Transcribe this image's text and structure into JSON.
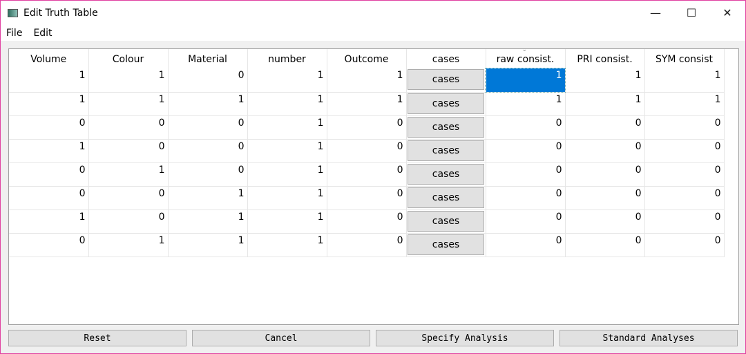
{
  "window": {
    "title": "Edit Truth Table",
    "minimize": "—",
    "maximize": "☐",
    "close": "✕"
  },
  "menu": [
    "File",
    "Edit"
  ],
  "table": {
    "headers": [
      "Volume",
      "Colour",
      "Material",
      "number",
      "Outcome",
      "cases",
      "raw consist.",
      "PRI consist.",
      "SYM consist"
    ],
    "cases_label": "cases",
    "selected": {
      "row": 0,
      "column": "raw consist."
    },
    "rows": [
      [
        "1",
        "1",
        "0",
        "1",
        "1",
        "1",
        "1",
        "1"
      ],
      [
        "1",
        "1",
        "1",
        "1",
        "1",
        "1",
        "1",
        "1"
      ],
      [
        "0",
        "0",
        "0",
        "1",
        "0",
        "0",
        "0",
        "0"
      ],
      [
        "1",
        "0",
        "0",
        "1",
        "0",
        "0",
        "0",
        "0"
      ],
      [
        "0",
        "1",
        "0",
        "1",
        "0",
        "0",
        "0",
        "0"
      ],
      [
        "0",
        "0",
        "1",
        "1",
        "0",
        "0",
        "0",
        "0"
      ],
      [
        "1",
        "0",
        "1",
        "1",
        "0",
        "0",
        "0",
        "0"
      ],
      [
        "0",
        "1",
        "1",
        "1",
        "0",
        "0",
        "0",
        "0"
      ]
    ]
  },
  "buttons": {
    "reset": "Reset",
    "cancel": "Cancel",
    "specify": "Specify Analysis",
    "standard": "Standard Analyses"
  }
}
